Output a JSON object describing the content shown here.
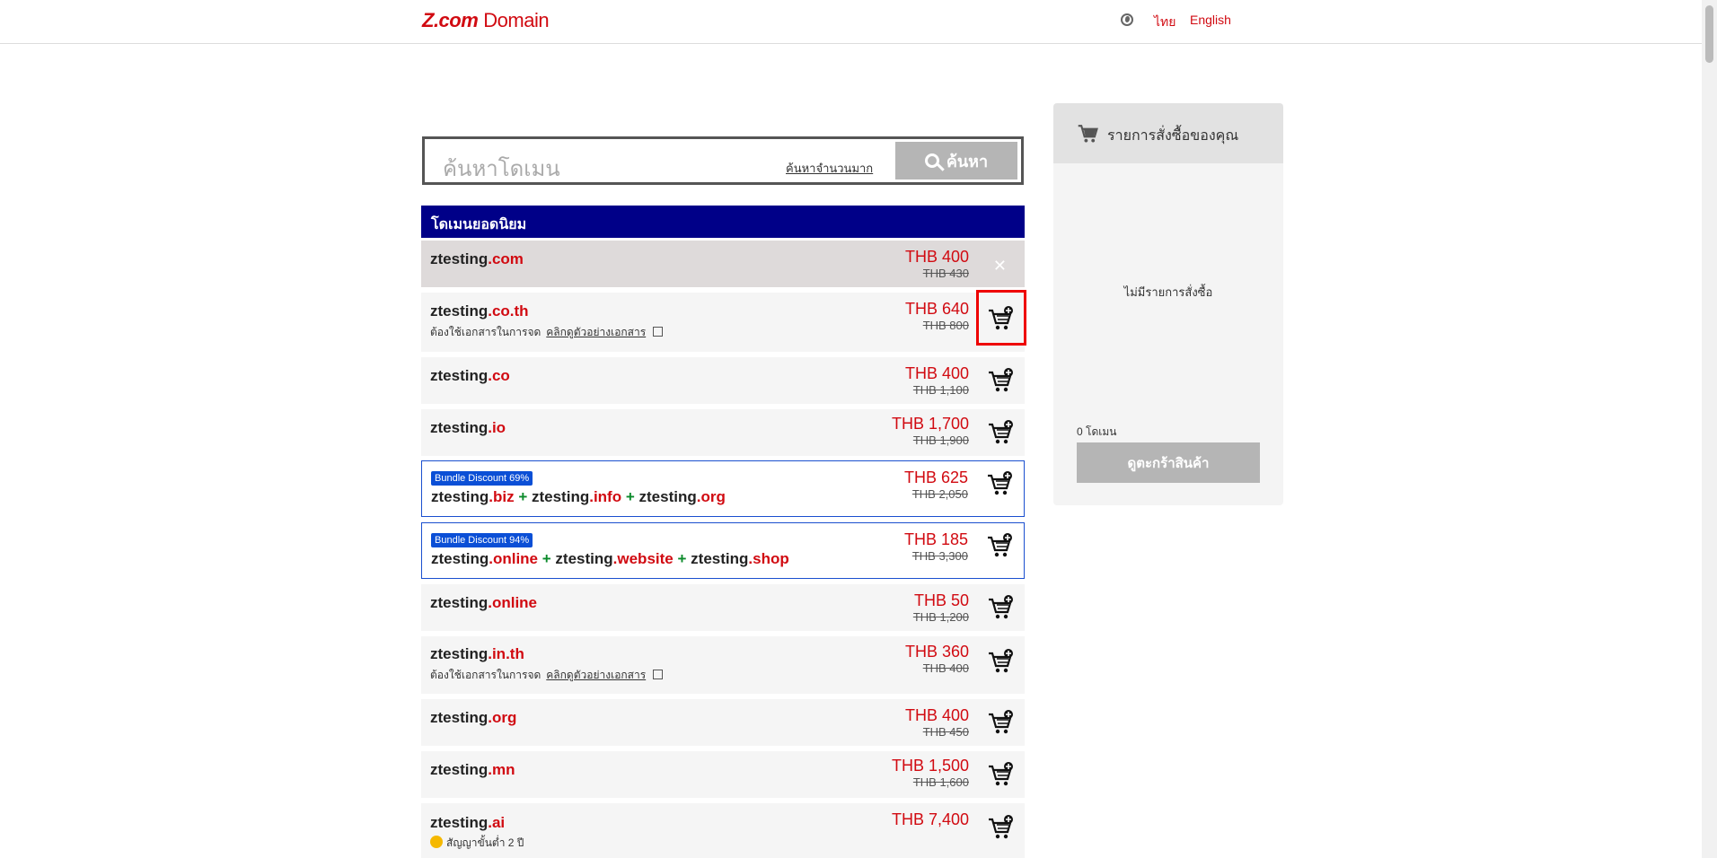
{
  "header": {
    "logo_brand": "Z.com",
    "logo_suffix": "Domain",
    "lang_thai": "ไทย",
    "lang_english": "English"
  },
  "search": {
    "placeholder": "ค้นหาโดเมน",
    "bulk_link": "ค้นหาจำนวนมาก",
    "button_label": "ค้นหา"
  },
  "popular": {
    "heading": "โดเมนยอดนิยม",
    "doc_required": "ต้องใช้เอกสารในการจด",
    "doc_example": "คลิกดูตัวอย่างเอกสาร",
    "min_contract": "สัญญาขั้นต่ำ 2 ปี",
    "rows": [
      {
        "name": "ztesting",
        "tld": ".com",
        "price": "THB 400",
        "old": "THB 430"
      },
      {
        "name": "ztesting",
        "tld": ".co.th",
        "price": "THB 640",
        "old": "THB 800"
      },
      {
        "name": "ztesting",
        "tld": ".co",
        "price": "THB 400",
        "old": "THB 1,100"
      },
      {
        "name": "ztesting",
        "tld": ".io",
        "price": "THB 1,700",
        "old": "THB 1,900"
      },
      {
        "badge": "Bundle Discount 69%",
        "names": [
          "ztesting",
          ".biz",
          "ztesting",
          ".info",
          "ztesting",
          ".org"
        ],
        "price": "THB 625",
        "old": "THB 2,050"
      },
      {
        "badge": "Bundle Discount 94%",
        "names": [
          "ztesting",
          ".online",
          "ztesting",
          ".website",
          "ztesting",
          ".shop"
        ],
        "price": "THB 185",
        "old": "THB 3,300"
      },
      {
        "name": "ztesting",
        "tld": ".online",
        "price": "THB 50",
        "old": "THB 1,200"
      },
      {
        "name": "ztesting",
        "tld": ".in.th",
        "price": "THB 360",
        "old": "THB 400"
      },
      {
        "name": "ztesting",
        "tld": ".org",
        "price": "THB 400",
        "old": "THB 450"
      },
      {
        "name": "ztesting",
        "tld": ".mn",
        "price": "THB 1,500",
        "old": "THB 1,600"
      },
      {
        "name": "ztesting",
        "tld": ".ai",
        "price": "THB 7,400",
        "old": ""
      }
    ],
    "plus": "+"
  },
  "cart_panel": {
    "title": "รายการสั่งซื้อของคุณ",
    "empty": "ไม่มีรายการสั่งซื้อ",
    "count": "0 โดเมน",
    "view_button": "ดูตะกร้าสินค้า"
  },
  "colors": {
    "brand": "#d10a11",
    "list_header": "#000088",
    "bundle_border": "#1a4fcf",
    "badge": "#0b4fd6"
  }
}
